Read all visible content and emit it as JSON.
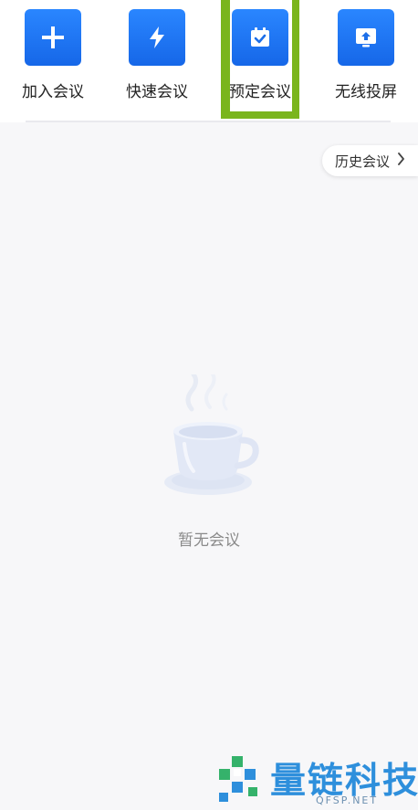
{
  "actions": [
    {
      "label": "加入会议",
      "icon": "plus-icon"
    },
    {
      "label": "快速会议",
      "icon": "lightning-icon"
    },
    {
      "label": "预定会议",
      "icon": "calendar-check-icon"
    },
    {
      "label": "无线投屏",
      "icon": "screen-share-icon"
    }
  ],
  "history": {
    "label": "历史会议",
    "icon": "chevron-right-icon"
  },
  "empty_state": {
    "text": "暂无会议",
    "icon": "coffee-cup-icon"
  },
  "watermark": {
    "brand": "量链科技",
    "site": "QFSP.NET"
  },
  "colors": {
    "accent": "#1f78f5",
    "highlight": "#7ab51d",
    "watermark": "#2e8fdc"
  }
}
